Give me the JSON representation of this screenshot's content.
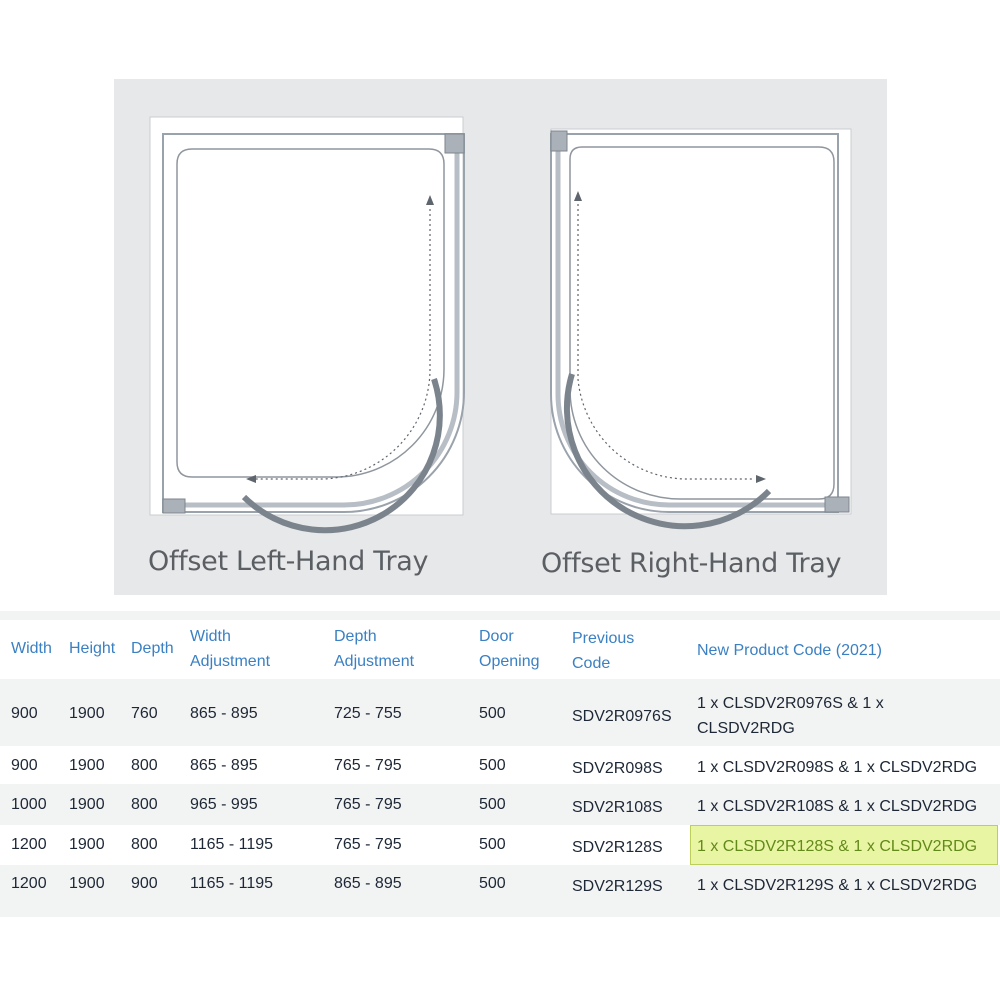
{
  "diagram": {
    "left_tray_label": "Offset Left-Hand Tray",
    "right_tray_label": "Offset Right-Hand Tray"
  },
  "table": {
    "headers": {
      "width": "Width",
      "height": "Height",
      "depth": "Depth",
      "width_adjustment_1": "Width",
      "width_adjustment_2": "Adjustment",
      "depth_adjustment_1": "Depth",
      "depth_adjustment_2": "Adjustment",
      "door_opening_1": "Door",
      "door_opening_2": "Opening",
      "previous_code_1": "Previous",
      "previous_code_2": "Code",
      "new_code": "New Product Code (2021)"
    },
    "rows": [
      {
        "width": "900",
        "height": "1900",
        "depth": "760",
        "width_adj": "865 - 895",
        "depth_adj": "725 - 755",
        "door": "500",
        "prev": "SDV2R0976S",
        "new_line1": "1 x CLSDV2R0976S & 1 x",
        "new_line2": "CLSDV2RDG"
      },
      {
        "width": "900",
        "height": "1900",
        "depth": "800",
        "width_adj": "865 - 895",
        "depth_adj": "765 - 795",
        "door": "500",
        "prev": "SDV2R098S",
        "new": "1 x CLSDV2R098S & 1 x CLSDV2RDG"
      },
      {
        "width": "1000",
        "height": "1900",
        "depth": "800",
        "width_adj": "965 - 995",
        "depth_adj": "765 - 795",
        "door": "500",
        "prev": "SDV2R108S",
        "new": "1 x CLSDV2R108S & 1 x CLSDV2RDG"
      },
      {
        "width": "1200",
        "height": "1900",
        "depth": "800",
        "width_adj": "1165 - 1195",
        "depth_adj": "765 - 795",
        "door": "500",
        "prev": "SDV2R128S",
        "new": "1 x CLSDV2R128S & 1 x CLSDV2RDG"
      },
      {
        "width": "1200",
        "height": "1900",
        "depth": "900",
        "width_adj": "1165 - 1195",
        "depth_adj": "865 - 895",
        "door": "500",
        "prev": "SDV2R129S",
        "new": "1 x CLSDV2R129S & 1 x CLSDV2RDG"
      }
    ]
  },
  "colors": {
    "header_text": "#3a80c3",
    "body_text": "#1d2735",
    "highlight_bg": "#e8f5a2",
    "highlight_text": "#63891b"
  }
}
